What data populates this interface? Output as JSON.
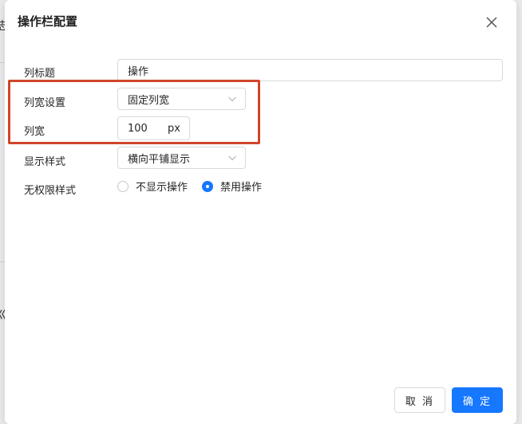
{
  "background": {
    "glyph_top": "志",
    "glyph_mid": "巛"
  },
  "dialog": {
    "title": "操作栏配置",
    "close_icon": "close-icon"
  },
  "form": {
    "column_title": {
      "label": "列标题",
      "value": "操作"
    },
    "width_setting": {
      "label": "列宽设置",
      "value": "固定列宽"
    },
    "column_width": {
      "label": "列宽",
      "value": "100",
      "unit": "px"
    },
    "display_style": {
      "label": "显示样式",
      "value": "横向平铺显示"
    },
    "no_permission_style": {
      "label": "无权限样式",
      "options": [
        {
          "label": "不显示操作",
          "checked": false
        },
        {
          "label": "禁用操作",
          "checked": true
        }
      ]
    }
  },
  "footer": {
    "cancel_label": "取 消",
    "ok_label": "确 定"
  },
  "colors": {
    "primary": "#1677ff",
    "highlight_border": "#d0452c"
  }
}
